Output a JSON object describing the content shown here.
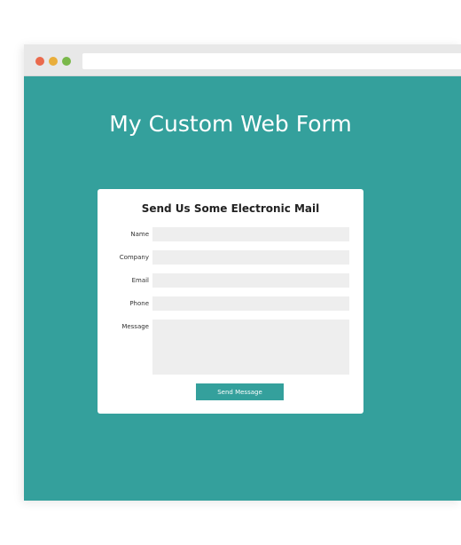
{
  "colors": {
    "page_background": "#34a09c",
    "accent": "#34a09c",
    "window_dot_red": "#ea6a4d",
    "window_dot_yellow": "#e9ae3b",
    "window_dot_green": "#7ab84a"
  },
  "page": {
    "title": "My Custom Web Form"
  },
  "form": {
    "heading": "Send Us Some Electronic Mail",
    "fields": [
      {
        "label": "Name",
        "value": ""
      },
      {
        "label": "Company",
        "value": ""
      },
      {
        "label": "Email",
        "value": ""
      },
      {
        "label": "Phone",
        "value": ""
      },
      {
        "label": "Message",
        "value": ""
      }
    ],
    "submit_label": "Send Message"
  }
}
